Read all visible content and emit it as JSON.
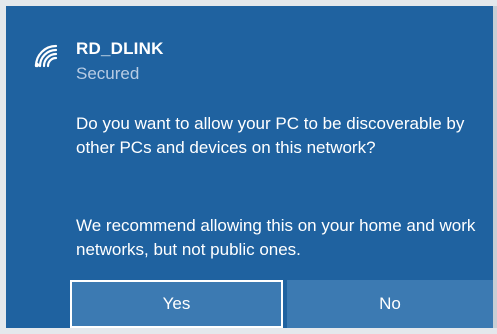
{
  "network": {
    "name": "RD_DLINK",
    "status": "Secured",
    "icon": "wifi-icon"
  },
  "prompt": {
    "question": "Do you want to allow your PC to be discoverable by other PCs and devices on this network?",
    "recommendation": "We recommend allowing this on your home and work networks, but not public ones."
  },
  "buttons": {
    "yes_label": "Yes",
    "no_label": "No"
  },
  "colors": {
    "panel_background": "#1f62a0",
    "button_background": "#3c7ab2",
    "secondary_text": "#b8cce4"
  }
}
